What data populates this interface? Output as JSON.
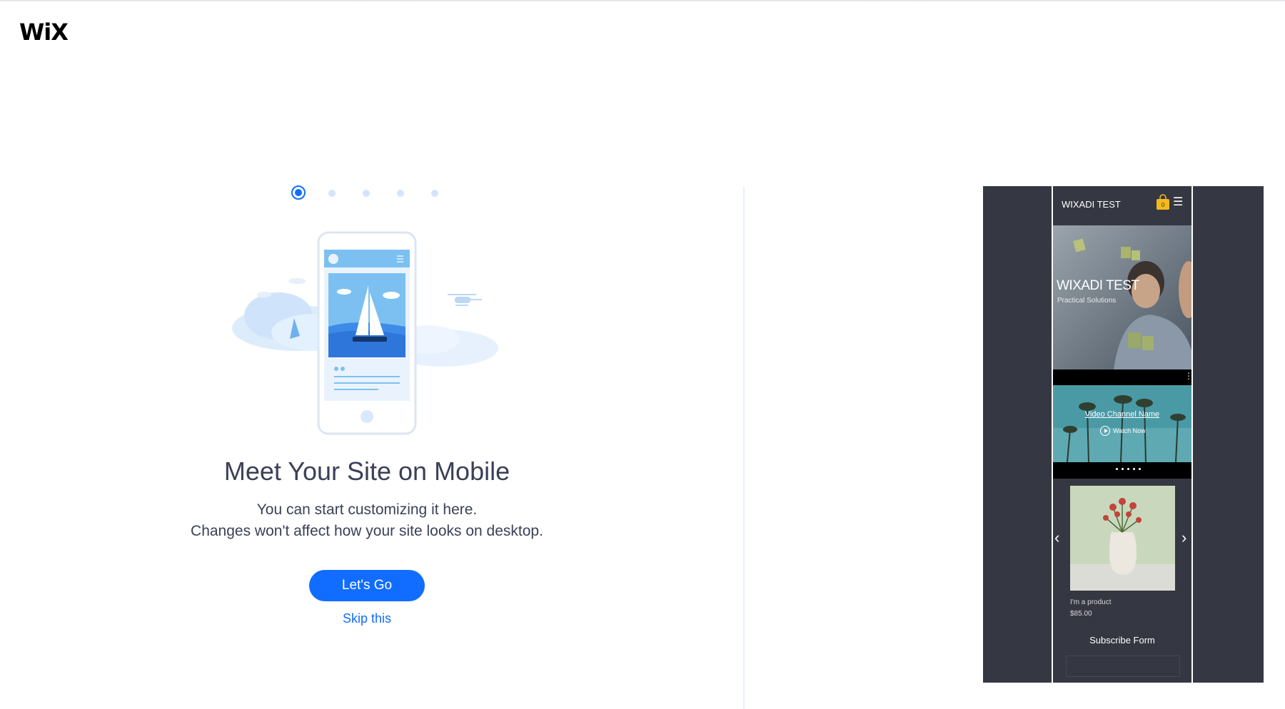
{
  "app": {
    "logo_text": "WiX"
  },
  "onboarding": {
    "steps_total": 5,
    "current_step": 1,
    "title": "Meet Your Site on Mobile",
    "subtitle_line1": "You can start customizing it here.",
    "subtitle_line2": "Changes won't affect how your site looks on desktop.",
    "primary_button": "Let's Go",
    "skip_link": "Skip this"
  },
  "mobile_preview": {
    "site_name": "WIXADI TEST",
    "cart_count": "0",
    "hero_title": "WIXADI TEST",
    "hero_subtitle": "Practical Solutions",
    "video_title": "Video Channel Name",
    "video_action": "Watch Now",
    "product_name": "I'm a product",
    "product_price": "$85.00",
    "subscribe_title": "Subscribe Form"
  },
  "colors": {
    "accent": "#116dff",
    "text": "#3b4057",
    "preview_bg": "#353742"
  }
}
